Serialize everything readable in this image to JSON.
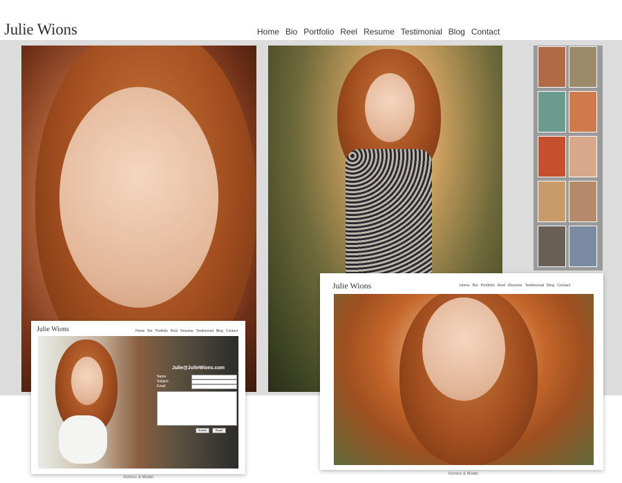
{
  "site": {
    "logo": "Julie Wions",
    "nav": [
      "Home",
      "Bio",
      "Portfolio",
      "Reel",
      "Resume",
      "Testimonial",
      "Blog",
      "Contact"
    ]
  },
  "thumbnails_count": 10,
  "contact_inset": {
    "logo": "Julie Wions",
    "nav": [
      "Home",
      "Bio",
      "Portfolio",
      "Reel",
      "Resume",
      "Testimonial",
      "Blog",
      "Contact"
    ],
    "email": "Julie@JulieWions.com",
    "form": {
      "name_label": "Name",
      "subject_label": "Subject",
      "email_label": "Email",
      "submit_label": "Submit",
      "reset_label": "Reset"
    },
    "caption": "Actress & Model"
  },
  "home_inset": {
    "logo": "Julie Wions",
    "nav": [
      "Home",
      "Bio",
      "Portfolio",
      "Reel",
      "Resume",
      "Testimonial",
      "Blog",
      "Contact"
    ],
    "caption": "Actress & Model"
  }
}
